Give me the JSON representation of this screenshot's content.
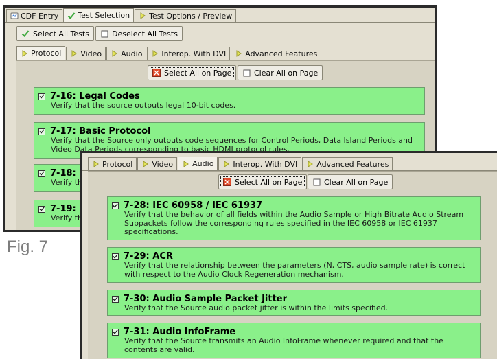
{
  "colors": {
    "card_green": "#8af08a",
    "window_bg": "#e4e0d2",
    "tab_arrow": "#e6e65a",
    "checkmark": "#3ea83e",
    "page_select_icon": "#e04a2a"
  },
  "caption": "Fig. 7",
  "window1": {
    "top_tabs": [
      {
        "label": "CDF Entry",
        "icon": "cdf-icon"
      },
      {
        "label": "Test Selection",
        "icon": "checkmark-icon"
      },
      {
        "label": "Test Options / Preview",
        "icon": "arrow-right-icon"
      }
    ],
    "active_top_tab": "Test Selection",
    "select_all_tests": "Select All Tests",
    "deselect_all_tests": "Deselect All Tests",
    "sub_tabs": [
      "Protocol",
      "Video",
      "Audio",
      "Interop. With DVI",
      "Advanced Features"
    ],
    "active_sub_tab": "Protocol",
    "select_all_on_page": "Select All on Page",
    "clear_all_on_page": "Clear All on Page",
    "tests": [
      {
        "title": "7-16: Legal Codes",
        "desc": "Verify that the source outputs legal 10-bit codes.",
        "checked": true
      },
      {
        "title": "7-17: Basic Protocol",
        "desc": "Verify that the Source only outputs code sequences for Control Periods, Data Island Periods and Video Data Periods corresponding to basic HDMI protocol rules.",
        "checked": true
      },
      {
        "title": "7-18:",
        "desc": "Verify tha",
        "checked": true
      },
      {
        "title": "7-19:",
        "desc": "Verify tha",
        "checked": true
      }
    ]
  },
  "window2": {
    "sub_tabs": [
      "Protocol",
      "Video",
      "Audio",
      "Interop. With DVI",
      "Advanced Features"
    ],
    "active_sub_tab": "Audio",
    "select_all_on_page": "Select All on Page",
    "clear_all_on_page": "Clear All on Page",
    "tests": [
      {
        "title": "7-28: IEC 60958 / IEC 61937",
        "desc": "Verify that the behavior of all fields within the Audio Sample or High Bitrate Audio Stream Subpackets follow the corresponding rules specified in the IEC 60958 or IEC 61937 specifications.",
        "checked": true
      },
      {
        "title": "7-29: ACR",
        "desc": "Verify that the relationship between the parameters (N, CTS, audio sample rate) is correct with respect to the Audio Clock Regeneration mechanism.",
        "checked": true
      },
      {
        "title": "7-30: Audio Sample Packet Jitter",
        "desc": "Verify that the Source audio packet jitter is within the limits specified.",
        "checked": true
      },
      {
        "title": "7-31: Audio InfoFrame",
        "desc": "Verify that the Source transmits an Audio InfoFrame whenever required and that the contents are valid.",
        "checked": true
      }
    ]
  }
}
